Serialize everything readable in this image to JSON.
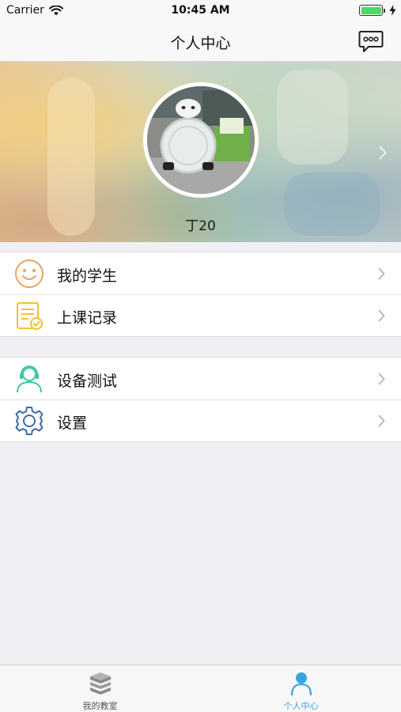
{
  "status_bar": {
    "carrier": "Carrier",
    "time": "10:45 AM",
    "battery_level": 1.0,
    "wifi_icon": "wifi-icon",
    "charging_icon": "bolt-icon"
  },
  "nav": {
    "title": "个人中心",
    "message_icon": "chat-bubble-icon"
  },
  "profile": {
    "name": "丁20"
  },
  "menu_groups": [
    {
      "items": [
        {
          "label": "我的学生",
          "icon": "smiley-icon",
          "color": "#f0a05a"
        },
        {
          "label": "上课记录",
          "icon": "record-document-icon",
          "color": "#f2c230"
        }
      ]
    },
    {
      "items": [
        {
          "label": "设备测试",
          "icon": "headset-user-icon",
          "color": "#3cc8a0"
        },
        {
          "label": "设置",
          "icon": "gear-icon",
          "color": "#3d6aa8"
        }
      ]
    }
  ],
  "tab_bar": {
    "tabs": [
      {
        "label": "我的教室",
        "icon": "books-icon",
        "active": false
      },
      {
        "label": "个人中心",
        "icon": "person-icon",
        "active": true
      }
    ],
    "active_color": "#3ba4dc",
    "inactive_color": "#555555"
  }
}
